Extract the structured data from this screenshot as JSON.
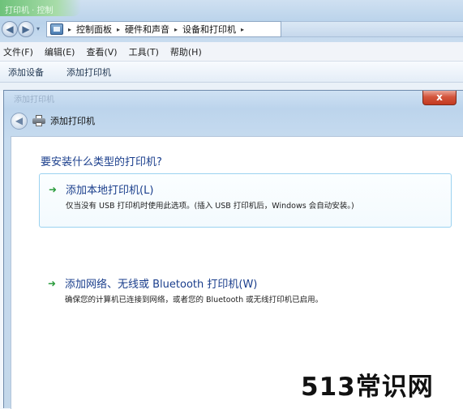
{
  "explorer": {
    "title_blur": "打印机 · 控制",
    "breadcrumbs": [
      "控制面板",
      "硬件和声音",
      "设备和打印机"
    ],
    "breadcrumb_sep": "▸",
    "menu": [
      "文件(F)",
      "编辑(E)",
      "查看(V)",
      "工具(T)",
      "帮助(H)"
    ],
    "toolbar": [
      "添加设备",
      "添加打印机"
    ]
  },
  "dialog": {
    "caption_blur": "添加打印机",
    "close_label": "x",
    "title": "添加打印机",
    "question": "要安装什么类型的打印机?",
    "options": [
      {
        "title": "添加本地打印机(L)",
        "desc": "仅当没有 USB 打印机时使用此选项。(插入 USB 打印机后，Windows 会自动安装。)"
      },
      {
        "title": "添加网络、无线或 Bluetooth 打印机(W)",
        "desc": "确保您的计算机已连接到网络，或者您的 Bluetooth 或无线打印机已启用。"
      }
    ]
  },
  "watermark": "513常识网",
  "icons": {
    "back": "back-arrow-icon",
    "forward": "forward-arrow-icon",
    "printer": "printer-icon",
    "option_arrow": "green-arrow-icon",
    "close": "close-icon"
  },
  "colors": {
    "link_blue": "#1a3e8c",
    "option_border": "#9bd2f0",
    "arrow_green": "#2a9c3c",
    "close_red": "#c23a20"
  }
}
